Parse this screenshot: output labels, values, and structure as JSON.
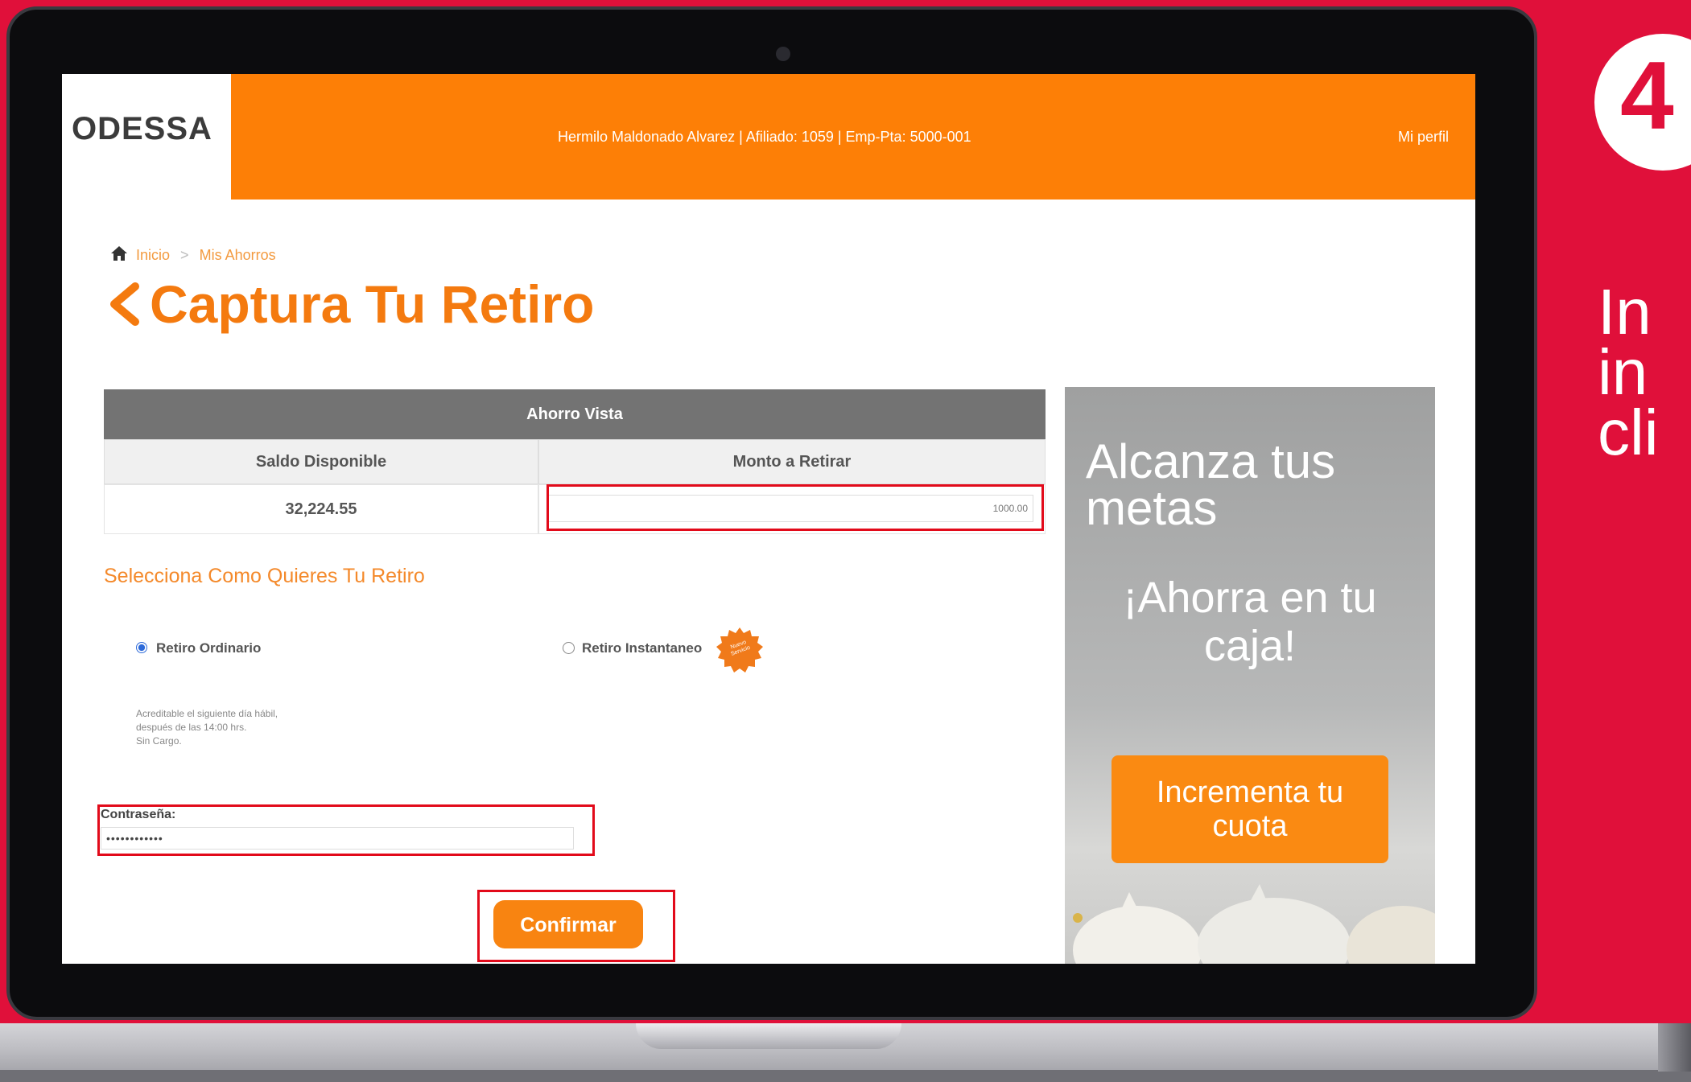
{
  "header": {
    "logo": "ODESSA",
    "user_info": "Hermilo Maldonado Alvarez | Afiliado: 1059 | Emp-Pta: 5000-001",
    "profile_link": "Mi perfil"
  },
  "breadcrumb": {
    "home": "Inicio",
    "separator": ">",
    "current": "Mis Ahorros"
  },
  "page_title": "Captura Tu Retiro",
  "table": {
    "title": "Ahorro Vista",
    "columns": [
      "Saldo Disponible",
      "Monto a Retirar"
    ],
    "saldo": "32,224.55",
    "monto_value": "1000.00"
  },
  "retiro": {
    "section_title": "Selecciona Como Quieres Tu Retiro",
    "option_ordinario": "Retiro Ordinario",
    "option_instantaneo": "Retiro Instantaneo",
    "badge": "Nuevo Servicio",
    "selected": "Retiro Ordinario",
    "description": [
      "Acreditable el siguiente día hábil,",
      "después de las 14:00 hrs.",
      "Sin Cargo."
    ]
  },
  "password": {
    "label": "Contraseña:",
    "value": "••••••••••••"
  },
  "confirm_label": "Confirmar",
  "ad": {
    "line1": "Alcanza tus metas",
    "line2": "¡Ahorra en tu caja!",
    "button": "Incrementa tu cuota"
  },
  "slide": {
    "step": "4",
    "text": "In\nin\ncli"
  },
  "colors": {
    "brand_orange": "#fd7f06",
    "slide_red": "#e0103a",
    "highlight": "#e20a1a"
  }
}
